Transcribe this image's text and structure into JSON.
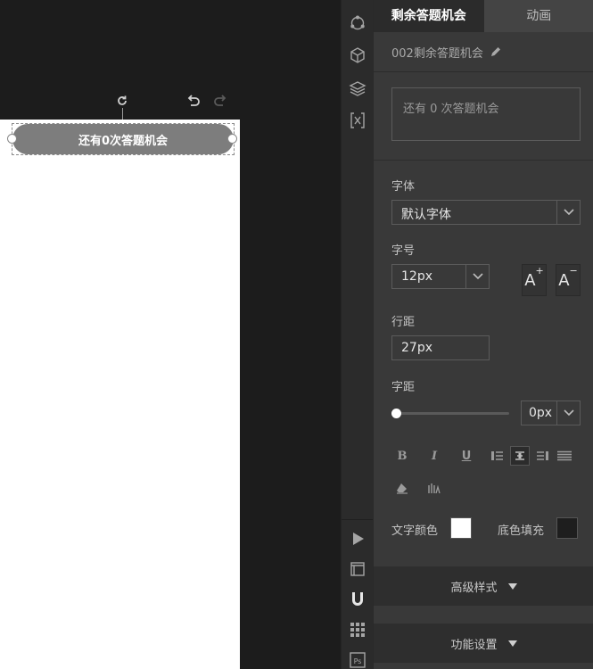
{
  "canvas": {
    "element_text": "还有0次答题机会"
  },
  "panel": {
    "tabs": [
      {
        "label": "剩余答题机会"
      },
      {
        "label": "动画"
      }
    ],
    "element_name": "002剩余答题机会",
    "text_content": "还有  0  次答题机会",
    "font_label": "字体",
    "font_value": "默认字体",
    "size_label": "字号",
    "size_value": "12px",
    "line_height_label": "行距",
    "line_height_value": "27px",
    "letter_spacing_label": "字距",
    "letter_spacing_value": "0px",
    "letter_spacing_slider": 0,
    "text_color_label": "文字颜色",
    "text_color": "#ffffff",
    "bg_fill_label": "底色填充",
    "bg_fill_color": "#1e1e1e",
    "advanced_label": "高级样式",
    "function_label": "功能设置"
  }
}
